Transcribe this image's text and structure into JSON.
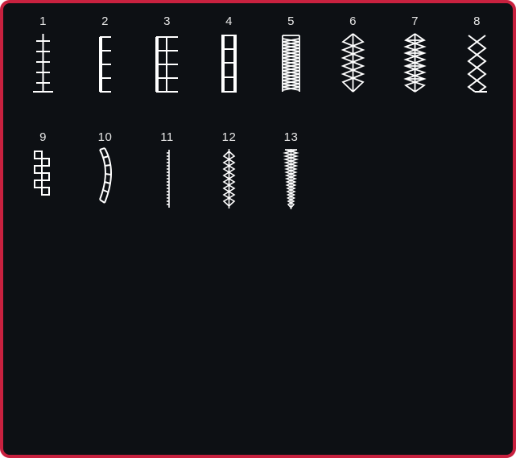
{
  "panel": {
    "accent_color": "#c8213f",
    "background_color": "#0d1014",
    "stitch_color": "#ffffff"
  },
  "stitches": [
    {
      "number": "1",
      "icon": "triple-straight-stitch-icon"
    },
    {
      "number": "2",
      "icon": "blanket-stitch-icon"
    },
    {
      "number": "3",
      "icon": "double-blanket-stitch-icon"
    },
    {
      "number": "4",
      "icon": "ladder-stitch-icon"
    },
    {
      "number": "5",
      "icon": "zigzag-bar-stitch-icon"
    },
    {
      "number": "6",
      "icon": "diamond-chain-stitch-icon"
    },
    {
      "number": "7",
      "icon": "double-diamond-stitch-icon"
    },
    {
      "number": "8",
      "icon": "cross-stitch-icon"
    },
    {
      "number": "9",
      "icon": "greek-key-stitch-icon"
    },
    {
      "number": "10",
      "icon": "curved-scallop-stitch-icon"
    },
    {
      "number": "11",
      "icon": "satin-bar-stitch-icon"
    },
    {
      "number": "12",
      "icon": "narrow-diamond-stitch-icon"
    },
    {
      "number": "13",
      "icon": "tapered-point-stitch-icon"
    }
  ]
}
